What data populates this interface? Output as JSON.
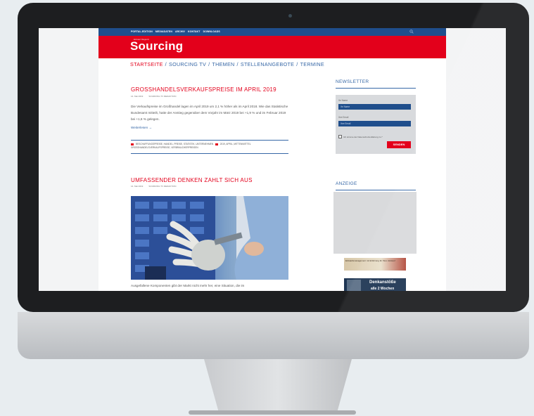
{
  "topbar": {
    "nav": [
      "PORTAL-EDITION",
      "MEDIADATEN",
      "ARCHIV",
      "KONTAKT",
      "DOWNLOADS"
    ]
  },
  "brand": {
    "tagline": "Einkauf Magazin",
    "logo": "Sourcing"
  },
  "main_nav": {
    "items": [
      "STARTSEITE",
      "SOURCING TV",
      "THEMEN",
      "STELLENANGEBOTE",
      "TERMINE"
    ],
    "separator": "/"
  },
  "articles": [
    {
      "title": "GROSSHANDELSVERKAUFSPREISE IM APRIL 2019",
      "date": "14. Mai 2019",
      "author": "SOURCING TV REDAKTION",
      "body": "Die Verkaufspreise im Großhandel lagen im April 2019 um 2,1 % höher als im April 2018. Wie das Statistische Bundesamt mitteilt, hatte der Anstieg gegenüber dem Vorjahr im März 2019 bei +1,9 % und im Februar 2019 bei +1,6 % gelegen.",
      "read_more": "Weiterlesen →",
      "tags_left": "BESCHAFFUNGSPREISE, HANDEL, PREISE, STATISTIK, UNTERNEHMEN",
      "tags_right": "2019, APRIL, MITTEN/MITTEL",
      "tags_second": "GROSSHANDELSVERKAUFSPREISE, VERBRAUCHERPREISEN"
    },
    {
      "title": "UMFASSENDER DENKEN ZAHLT SICH AUS",
      "date": "14. Mai 2019",
      "author": "SOURCING TV REDAKTION",
      "body": "Ausgefallene Komponenten gibt der Markt nicht mehr her, eine Situation, die im"
    }
  ],
  "sidebar": {
    "newsletter_title": "NEWSLETTER",
    "name_label": "Ihr Name",
    "name_placeholder": "Ihr Name",
    "email_label": "Ihre Email",
    "email_placeholder": "Ihre Email",
    "privacy_text": "Ich stimme der Datenschutzerklärung zu.*",
    "send_label": "SENDEN",
    "ad_title": "ANZEIGE",
    "banner1_text": "Einkaufsmanagement mit Erfahrung für Ihren Einkauf",
    "banner2_line1": "Denkanstöße",
    "banner2_line2": "alle 2 Wochen"
  },
  "colors": {
    "brand_red": "#e3001b",
    "brand_blue": "#1f4e8c",
    "link_blue": "#3667a6"
  }
}
